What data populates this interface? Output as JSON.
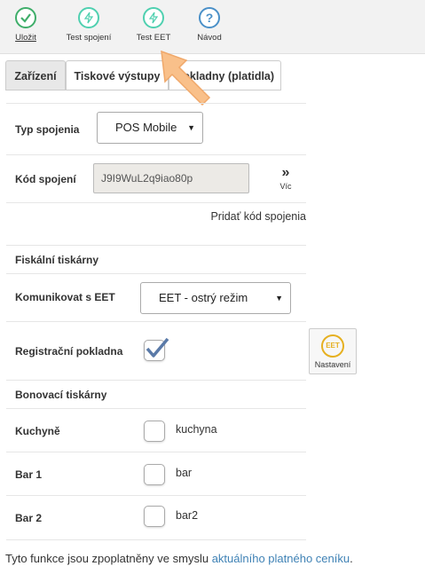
{
  "toolbar": {
    "save_label": "Uložit",
    "test_connection_label": "Test spojení",
    "test_eet_label": "Test EET",
    "help_label": "Návod"
  },
  "tabs": [
    "Zařízení",
    "Tiskové výstupy",
    "Pokladny (platidla)"
  ],
  "connection_type": {
    "label": "Typ spojenia",
    "value": "POS Mobile"
  },
  "connection_code": {
    "label": "Kód spojení",
    "value": "J9I9WuL2q9iao80p",
    "more_label": "Víc",
    "add_link": "Pridať kód spojenia"
  },
  "fiscal": {
    "heading": "Fiskální tiskárny",
    "eet_label": "Komunikovat s EET",
    "eet_value": "EET - ostrý režim",
    "register_label": "Registrační pokladna",
    "register_checked": true,
    "settings_label": "Nastavení",
    "settings_badge": "EET"
  },
  "receipt_printers": {
    "heading": "Bonovací tiskárny",
    "items": [
      {
        "label": "Kuchyně",
        "value": "kuchyna"
      },
      {
        "label": "Bar 1",
        "value": "bar"
      },
      {
        "label": "Bar 2",
        "value": "bar2"
      }
    ]
  },
  "footer": {
    "text": "Tyto funkce jsou zpoplatněny ve smyslu ",
    "link": "aktuálního platného ceníku",
    "end": "."
  },
  "colors": {
    "save": "#3fae6a",
    "test": "#4fd0b0",
    "help": "#4a90c8",
    "link": "#3f82b5",
    "eet_badge": "#e6b020"
  }
}
